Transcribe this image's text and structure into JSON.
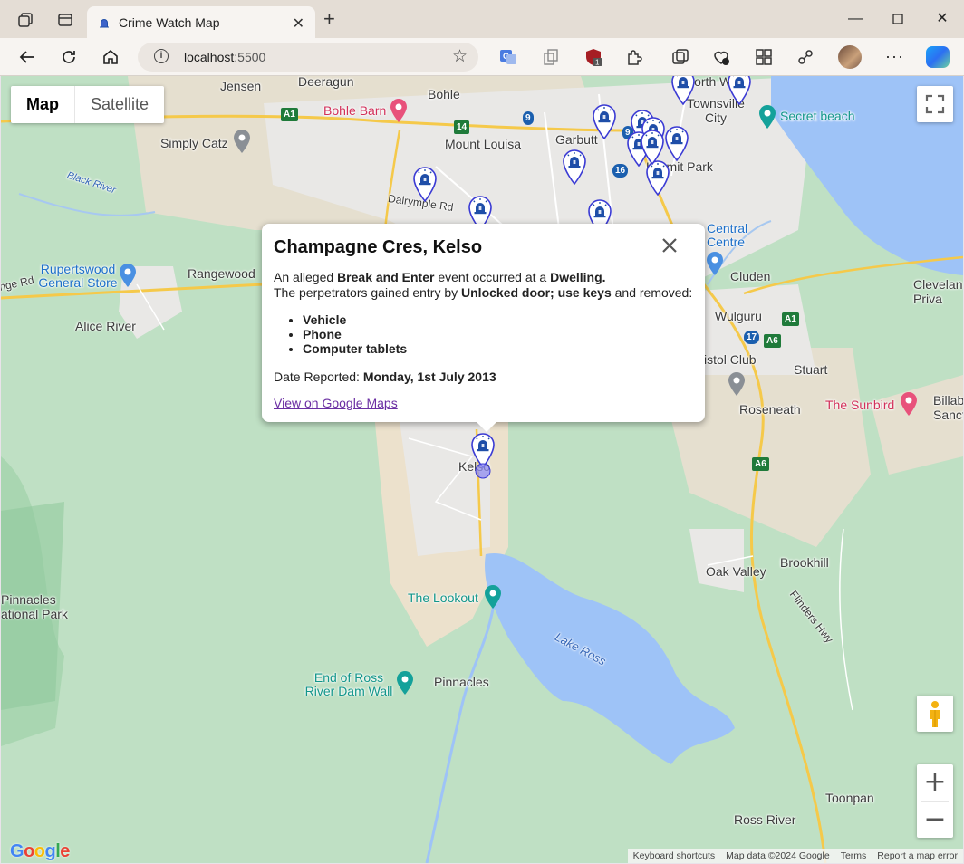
{
  "browser": {
    "tab_title": "Crime Watch Map",
    "url_host": "localhost",
    "url_port": ":5500"
  },
  "map": {
    "type_control": {
      "map_label": "Map",
      "satellite_label": "Satellite",
      "active": "Map"
    },
    "labels": {
      "jensen": "Jensen",
      "deeragun": "Deeragun",
      "bohle": "Bohle",
      "bohle_barn": "Bohle Barn",
      "north_ward": "North Ward",
      "townsville_city": "Townsville City",
      "secret_beach": "Secret beach",
      "simply_catz": "Simply Catz",
      "mount_louisa": "Mount Louisa",
      "garbutt": "Garbutt",
      "hermit_park": "Hermit Park",
      "black_river": "Black River",
      "dalrymple_rd": "Dalrymple Rd",
      "rupertswood": "Rupertswood General Store",
      "rangewood": "Rangewood",
      "range_rd": "nge Rd",
      "alice_river": "Alice River",
      "central_centre": "Central Centre",
      "cluden": "Cluden",
      "cleveland": "Clevelan Priva",
      "wulguru": "Wulguru",
      "bristol_club": "istol Club",
      "stuart": "Stuart",
      "the_sunbird": "The Sunbird",
      "billab": "Billab Sanct",
      "roseneath": "Roseneath",
      "kelso": "Kelso",
      "oak_valley": "Oak Valley",
      "brookhill": "Brookhill",
      "pinnacles_np": "Pinnacles ational Park",
      "the_lookout": "The Lookout",
      "lake_ross": "Lake Ross",
      "flinders_hwy": "Flinders Hwy",
      "end_of_ross": "End of Ross River Dam Wall",
      "pinnacles": "Pinnacles",
      "toonpan": "Toonpan",
      "ross_river": "Ross River"
    },
    "shields": [
      "A1",
      "14",
      "9",
      "16",
      "9",
      "A1",
      "17",
      "A6",
      "A6"
    ],
    "markers_count": 14,
    "attribution": [
      "Keyboard shortcuts",
      "Map data ©2024 Google",
      "Terms",
      "Report a map error"
    ],
    "zoom_in": "+",
    "zoom_out": "−",
    "google_logo": "Google"
  },
  "infowindow": {
    "title": "Champagne Cres, Kelso",
    "intro_prefix": "An alleged ",
    "event_type": "Break and Enter",
    "intro_mid": " event occurred at a ",
    "location_type": "Dwelling.",
    "entry_prefix": "The perpetrators gained entry by ",
    "entry_method": "Unlocked door; use keys",
    "entry_suffix": " and removed:",
    "items": [
      "Vehicle",
      "Phone",
      "Computer tablets"
    ],
    "date_prefix": "Date Reported: ",
    "date_value": "Monday, 1st July 2013",
    "link_text": "View on Google Maps"
  },
  "colors": {
    "marker_stroke": "#3b3bd4",
    "marker_icon": "#1f4ea8",
    "water": "#9ec3f7",
    "land": "#bfe0c4",
    "urban": "#e8e6e4",
    "road": "#f5c94a"
  }
}
